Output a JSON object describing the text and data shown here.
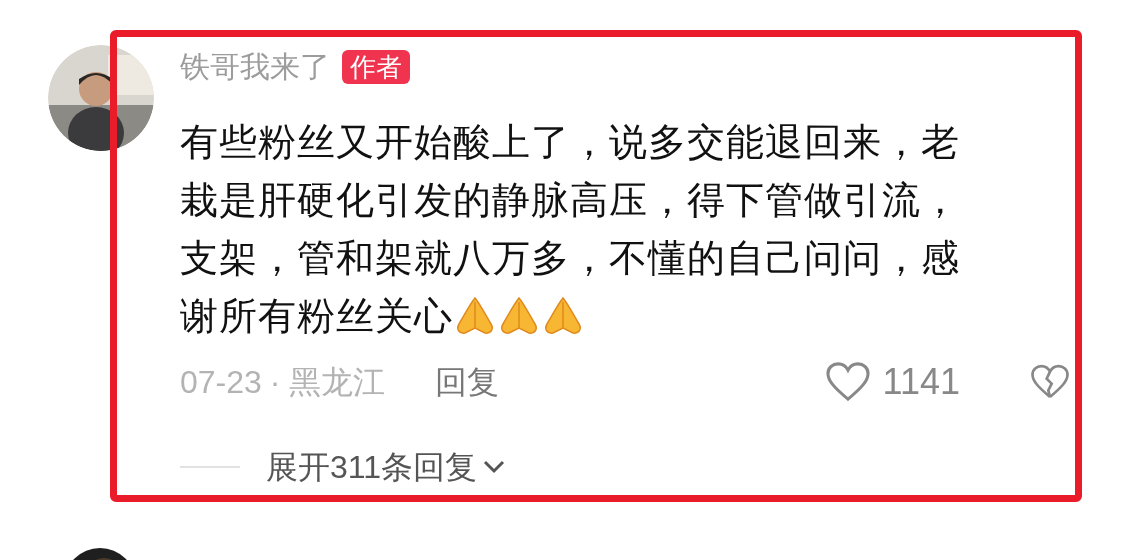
{
  "comment": {
    "author": "铁哥我来了",
    "badge": "作者",
    "text_lines": [
      "有些粉丝又开始酸上了，说多交能退回来，老",
      "栽是肝硬化引发的静脉高压，得下管做引流，",
      "支架，管和架就八万多，不懂的自己问问，感",
      "谢所有粉丝关心"
    ],
    "date": "07-23",
    "separator": "·",
    "location": "黑龙江",
    "reply": "回复",
    "likes": "1141",
    "liked": false,
    "expand_replies": "展开311条回复"
  }
}
